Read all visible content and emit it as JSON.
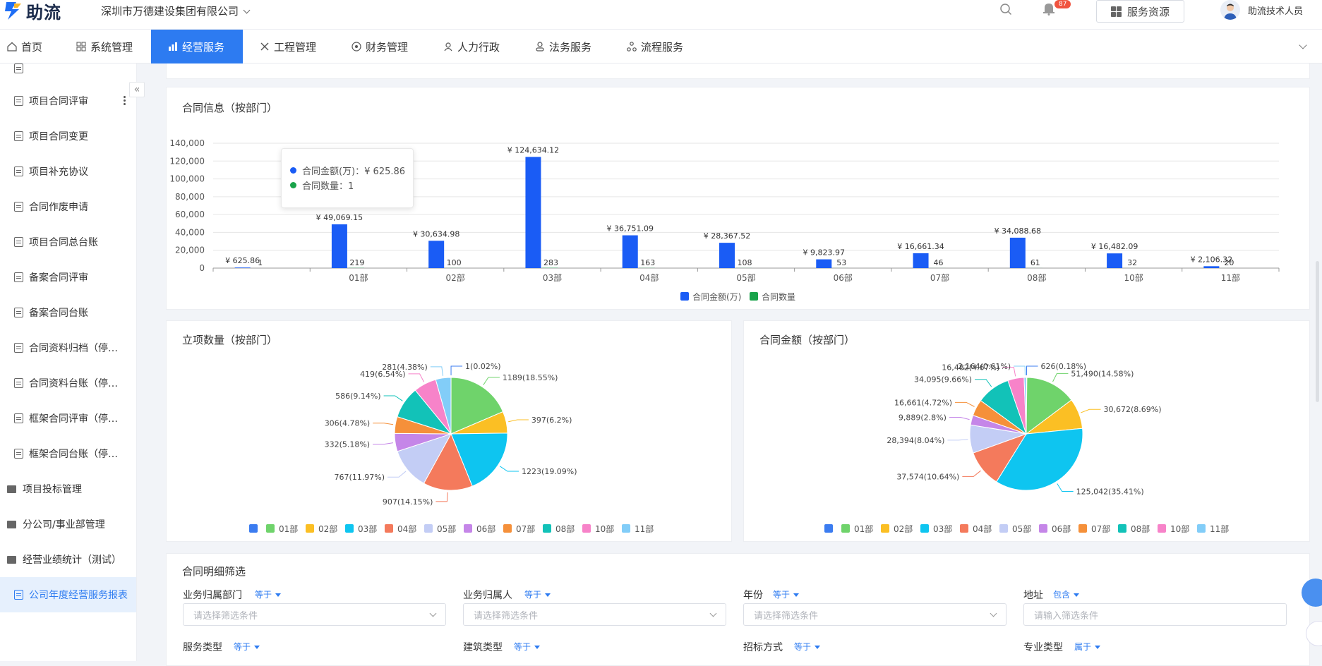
{
  "header": {
    "logo_text": "助流",
    "company": "深圳市万德建设集团有限公司",
    "notification_count": "87",
    "service_button": "服务资源",
    "user_name": "助流技术人员"
  },
  "nav": {
    "items": [
      {
        "label": "首页",
        "icon": "home-icon"
      },
      {
        "label": "系统管理",
        "icon": "grid-icon"
      },
      {
        "label": "经营服务",
        "icon": "bar-chart-icon"
      },
      {
        "label": "工程管理",
        "icon": "tools-icon"
      },
      {
        "label": "财务管理",
        "icon": "coin-icon"
      },
      {
        "label": "人力行政",
        "icon": "people-icon"
      },
      {
        "label": "法务服务",
        "icon": "person-icon"
      },
      {
        "label": "流程服务",
        "icon": "flow-icon"
      }
    ],
    "active_index": 2
  },
  "sidebar": {
    "items": [
      {
        "label": "项目合同评审",
        "type": "doc"
      },
      {
        "label": "项目合同变更",
        "type": "doc"
      },
      {
        "label": "项目补充协议",
        "type": "doc"
      },
      {
        "label": "合同作废申请",
        "type": "doc"
      },
      {
        "label": "项目合同总台账",
        "type": "doc"
      },
      {
        "label": "备案合同评审",
        "type": "doc"
      },
      {
        "label": "备案合同台账",
        "type": "doc"
      },
      {
        "label": "合同资料归档（停…",
        "type": "doc"
      },
      {
        "label": "合同资料台账（停…",
        "type": "doc"
      },
      {
        "label": "框架合同评审（停…",
        "type": "doc"
      },
      {
        "label": "框架合同台账（停…",
        "type": "doc"
      },
      {
        "label": "项目投标管理",
        "type": "folder"
      },
      {
        "label": "分公司/事业部管理",
        "type": "folder"
      },
      {
        "label": "经营业绩统计（测试）",
        "type": "folder"
      },
      {
        "label": "公司年度经营服务报表",
        "type": "doc",
        "active": true
      }
    ]
  },
  "tooltip": {
    "amount": "合同金额(万)：¥ 625.86",
    "count": "合同数量：1"
  },
  "chart_data": [
    {
      "type": "bar",
      "title": "合同信息（按部门）",
      "categories": [
        "",
        "01部",
        "02部",
        "03部",
        "04部",
        "05部",
        "06部",
        "07部",
        "08部",
        "10部",
        "11部"
      ],
      "series": [
        {
          "name": "合同金额(万)",
          "color": "#1a5cf5",
          "values": [
            625.86,
            49069.15,
            30634.98,
            124634.12,
            36751.09,
            28367.52,
            9823.97,
            16661.34,
            34088.68,
            16482.09,
            2106.32
          ],
          "labels": [
            "¥ 625.86",
            "¥ 49,069.15",
            "¥ 30,634.98",
            "¥ 124,634.12",
            "¥ 36,751.09",
            "¥ 28,367.52",
            "¥ 9,823.97",
            "¥ 16,661.34",
            "¥ 34,088.68",
            "¥ 16,482.09",
            "¥ 2,106.32"
          ]
        },
        {
          "name": "合同数量",
          "color": "#19a34a",
          "values": [
            1,
            219,
            100,
            283,
            163,
            108,
            53,
            46,
            61,
            32,
            20
          ]
        }
      ],
      "ylim": [
        0,
        140000
      ],
      "yticks": [
        "0",
        "20,000",
        "40,000",
        "60,000",
        "80,000",
        "100,000",
        "120,000",
        "140,000"
      ],
      "legend": "bottom"
    },
    {
      "type": "pie",
      "title": "立项数量（按部门）",
      "slices": [
        {
          "name": "",
          "value": 1,
          "label": "1(0.02%)",
          "color": "#3b7cf0"
        },
        {
          "name": "01部",
          "value": 1189,
          "label": "1189(18.55%)",
          "color": "#6fd36b"
        },
        {
          "name": "02部",
          "value": 397,
          "label": "397(6.2%)",
          "color": "#fbbf24"
        },
        {
          "name": "03部",
          "value": 1223,
          "label": "1223(19.09%)",
          "color": "#0ec5f0"
        },
        {
          "name": "04部",
          "value": 907,
          "label": "907(14.15%)",
          "color": "#f47a5c"
        },
        {
          "name": "05部",
          "value": 767,
          "label": "767(11.97%)",
          "color": "#c3cdf5"
        },
        {
          "name": "06部",
          "value": 332,
          "label": "332(5.18%)",
          "color": "#c586e8"
        },
        {
          "name": "07部",
          "value": 306,
          "label": "306(4.78%)",
          "color": "#f5903a"
        },
        {
          "name": "08部",
          "value": 586,
          "label": "586(9.14%)",
          "color": "#12c2b8"
        },
        {
          "name": "10部",
          "value": 419,
          "label": "419(6.54%)",
          "color": "#f783c9"
        },
        {
          "name": "11部",
          "value": 281,
          "label": "281(4.38%)",
          "color": "#82cdf8"
        }
      ],
      "legend": "bottom"
    },
    {
      "type": "pie",
      "title": "合同金额（按部门）",
      "slices": [
        {
          "name": "",
          "value": 626,
          "label": "626(0.18%)",
          "color": "#3b7cf0"
        },
        {
          "name": "01部",
          "value": 51490,
          "label": "51,490(14.58%)",
          "color": "#6fd36b"
        },
        {
          "name": "02部",
          "value": 30672,
          "label": "30,672(8.69%)",
          "color": "#fbbf24"
        },
        {
          "name": "03部",
          "value": 125042,
          "label": "125,042(35.41%)",
          "color": "#0ec5f0"
        },
        {
          "name": "04部",
          "value": 37574,
          "label": "37,574(10.64%)",
          "color": "#f47a5c"
        },
        {
          "name": "05部",
          "value": 28394,
          "label": "28,394(8.04%)",
          "color": "#c3cdf5"
        },
        {
          "name": "06部",
          "value": 9889,
          "label": "9,889(2.8%)",
          "color": "#c586e8"
        },
        {
          "name": "07部",
          "value": 16661,
          "label": "16,661(4.72%)",
          "color": "#f5903a"
        },
        {
          "name": "08部",
          "value": 34095,
          "label": "34,095(9.66%)",
          "color": "#12c2b8"
        },
        {
          "name": "10部",
          "value": 16482,
          "label": "16,482(4.67%)",
          "color": "#f783c9"
        },
        {
          "name": "11部",
          "value": 2164,
          "label": "2,164(0.61%)",
          "color": "#82cdf8"
        }
      ],
      "legend": "bottom"
    }
  ],
  "filters": {
    "title": "合同明细筛选",
    "fields": [
      {
        "label": "业务归属部门",
        "op": "等于",
        "placeholder": "请选择筛选条件",
        "select": true
      },
      {
        "label": "业务归属人",
        "op": "等于",
        "placeholder": "请选择筛选条件",
        "select": true
      },
      {
        "label": "年份",
        "op": "等于",
        "placeholder": "请选择筛选条件",
        "select": true
      },
      {
        "label": "地址",
        "op": "包含",
        "placeholder": "请输入筛选条件",
        "select": false
      },
      {
        "label": "服务类型",
        "op": "等于"
      },
      {
        "label": "建筑类型",
        "op": "等于"
      },
      {
        "label": "招标方式",
        "op": "等于"
      },
      {
        "label": "专业类型",
        "op": "属于"
      }
    ]
  }
}
